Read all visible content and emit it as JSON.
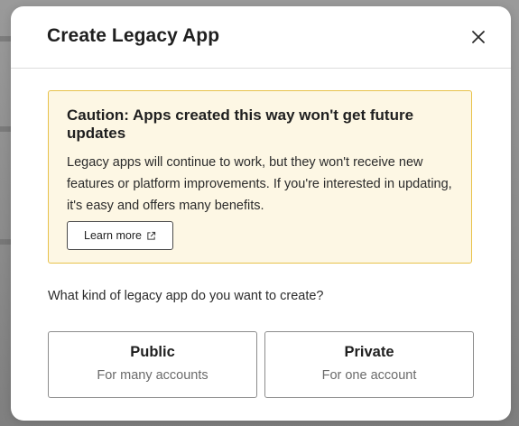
{
  "modal": {
    "title": "Create Legacy App",
    "close_icon": "close-icon"
  },
  "caution": {
    "title": "Caution: Apps created this way won't get future updates",
    "body": "Legacy apps will continue to work, but they won't receive new features or platform improvements. If you're interested in updating, it's easy and offers many benefits.",
    "learn_more_label": "Learn more",
    "external_icon": "external-link-icon",
    "border_color": "#e8c24b",
    "background_color": "#fdf7e4"
  },
  "question": "What kind of legacy app do you want to create?",
  "choices": [
    {
      "title": "Public",
      "subtitle": "For many accounts"
    },
    {
      "title": "Private",
      "subtitle": "For one account"
    }
  ]
}
